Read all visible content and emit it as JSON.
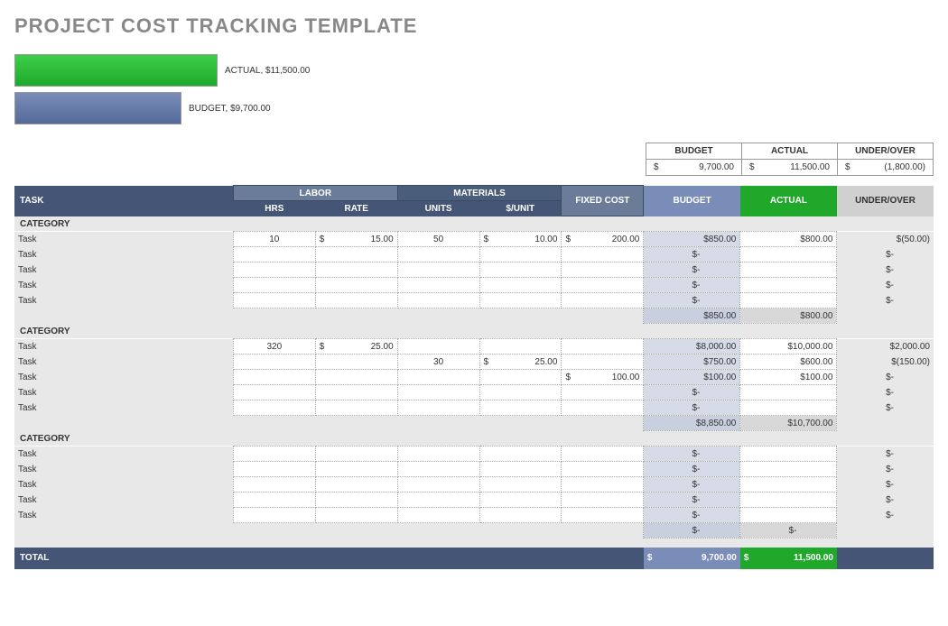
{
  "title": "PROJECT COST TRACKING TEMPLATE",
  "chart_data": {
    "type": "bar",
    "categories": [
      "ACTUAL",
      "BUDGET"
    ],
    "values": [
      11500.0,
      9700.0
    ],
    "labels": [
      "ACTUAL,  $11,500.00",
      "BUDGET,  $9,700.00"
    ]
  },
  "summary": {
    "headers": {
      "budget": "BUDGET",
      "actual": "ACTUAL",
      "underover": "UNDER/OVER"
    },
    "budget": "9,700.00",
    "actual": "11,500.00",
    "underover": "(1,800.00)"
  },
  "columns": {
    "task": "TASK",
    "labor": "LABOR",
    "materials": "MATERIALS",
    "fixed": "FIXED COST",
    "budget": "BUDGET",
    "actual": "ACTUAL",
    "underover": "UNDER/OVER",
    "hrs": "HRS",
    "rate": "RATE",
    "units": "UNITS",
    "perunit": "$/UNIT"
  },
  "cat_label": "CATEGORY",
  "task_label": "Task",
  "dash": "-",
  "cat1": {
    "r0": {
      "hrs": "10",
      "rate": "15.00",
      "units": "50",
      "perunit": "10.00",
      "fixed": "200.00",
      "budget": "850.00",
      "actual": "800.00",
      "underover": "(50.00)"
    },
    "subtotal": {
      "budget": "850.00",
      "actual": "800.00"
    }
  },
  "cat2": {
    "r0": {
      "hrs": "320",
      "rate": "25.00",
      "budget": "8,000.00",
      "actual": "10,000.00",
      "underover": "2,000.00"
    },
    "r1": {
      "units": "30",
      "perunit": "25.00",
      "budget": "750.00",
      "actual": "600.00",
      "underover": "(150.00)"
    },
    "r2": {
      "fixed": "100.00",
      "budget": "100.00",
      "actual": "100.00",
      "underover_dash": "-"
    },
    "subtotal": {
      "budget": "8,850.00",
      "actual": "10,700.00"
    }
  },
  "total": {
    "label": "TOTAL",
    "budget": "9,700.00",
    "actual": "11,500.00"
  }
}
